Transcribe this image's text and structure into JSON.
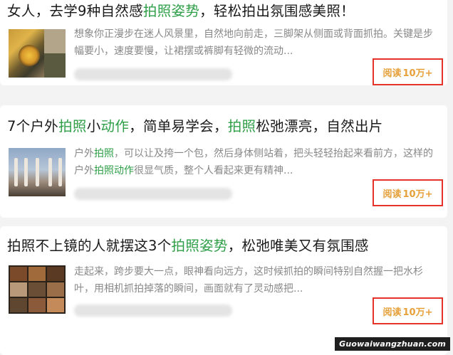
{
  "articles": [
    {
      "title_parts": [
        {
          "text": "女人，去学9种自然感",
          "hl": false
        },
        {
          "text": "拍照姿势",
          "hl": true
        },
        {
          "text": "，轻松拍出氛围感美照！",
          "hl": false
        }
      ],
      "snippet_parts": [
        {
          "text": "想象你正漫步在迷人风景里，自然地向前走，三脚架从侧面或背面抓拍。关键是步幅要小，速度要慢，让裙摆或裤脚有轻微的流动...",
          "hl": false
        }
      ],
      "read_label": "阅读",
      "read_count": "10万+"
    },
    {
      "title_parts": [
        {
          "text": "7个户外",
          "hl": false
        },
        {
          "text": "拍照",
          "hl": true
        },
        {
          "text": "小",
          "hl": false
        },
        {
          "text": "动作",
          "hl": true
        },
        {
          "text": "，简单易学会，",
          "hl": false
        },
        {
          "text": "拍照",
          "hl": true
        },
        {
          "text": "松弛漂亮，自然出片",
          "hl": false
        }
      ],
      "snippet_parts": [
        {
          "text": "户外",
          "hl": false
        },
        {
          "text": "拍照",
          "hl": true
        },
        {
          "text": "，可以让及挎一个包，然后身体侧站着，把头轻轻抬起来看前方，这样的户外",
          "hl": false
        },
        {
          "text": "拍照动作",
          "hl": true
        },
        {
          "text": "很显气质，整个人看起来更有精神...",
          "hl": false
        }
      ],
      "read_label": "阅读",
      "read_count": "10万+"
    },
    {
      "title_parts": [
        {
          "text": "拍照不上镜的人就摆这3个",
          "hl": false
        },
        {
          "text": "拍照姿势",
          "hl": true
        },
        {
          "text": "，松弛唯美又有氛围感",
          "hl": false
        }
      ],
      "snippet_parts": [
        {
          "text": "走起来，跨步要大一点，眼神看向远方，这时候抓拍的瞬间特别自然握一把水杉叶，用相机抓拍掉落的瞬间，画面就有了灵动感把...",
          "hl": false
        }
      ],
      "read_label": "阅读",
      "read_count": "10万+"
    }
  ],
  "watermark": "Guowaiwangzhuan.com",
  "colors": {
    "highlight": "#2e9e47",
    "read_text": "#e6a03a",
    "read_box": "#e5332a"
  }
}
